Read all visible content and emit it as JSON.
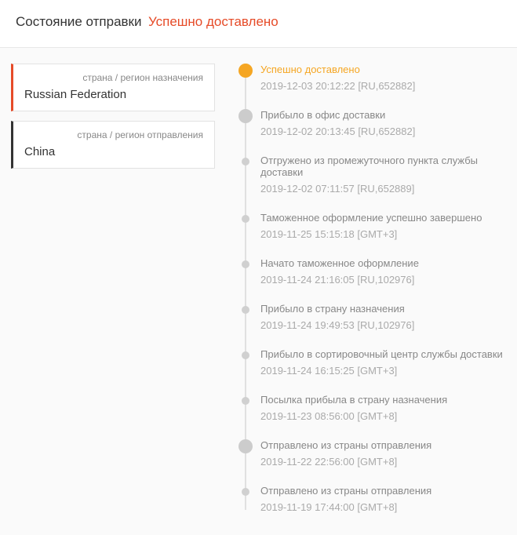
{
  "header": {
    "label": "Состояние отправки",
    "status": "Успешно доставлено"
  },
  "destination": {
    "label": "страна / регион назначения",
    "value": "Russian Federation"
  },
  "origin": {
    "label": "страна / регион отправления",
    "value": "China"
  },
  "events": [
    {
      "title": "Успешно доставлено",
      "time": "2019-12-03 20:12:22 [RU,652882]",
      "dot": "highlight",
      "active": true
    },
    {
      "title": "Прибыло в офис доставки",
      "time": "2019-12-02 20:13:45 [RU,652882]",
      "dot": "big"
    },
    {
      "title": "Отгружено из промежуточного пункта службы доставки",
      "time": "2019-12-02 07:11:57 [RU,652889]",
      "dot": "small"
    },
    {
      "title": "Таможенное оформление успешно завершено",
      "time": "2019-11-25 15:15:18 [GMT+3]",
      "dot": "small"
    },
    {
      "title": "Начато таможенное оформление",
      "time": "2019-11-24 21:16:05 [RU,102976]",
      "dot": "small"
    },
    {
      "title": "Прибыло в страну назначения",
      "time": "2019-11-24 19:49:53 [RU,102976]",
      "dot": "small"
    },
    {
      "title": "Прибыло в сортировочный центр службы доставки",
      "time": "2019-11-24 16:15:25 [GMT+3]",
      "dot": "small"
    },
    {
      "title": "Посылка прибыла в страну назначения",
      "time": "2019-11-23 08:56:00 [GMT+8]",
      "dot": "small"
    },
    {
      "title": "Отправлено из страны отправления",
      "time": "2019-11-22 22:56:00 [GMT+8]",
      "dot": "big"
    },
    {
      "title": "Отправлено из страны отправления",
      "time": "2019-11-19 17:44:00 [GMT+8]",
      "dot": "small"
    }
  ]
}
